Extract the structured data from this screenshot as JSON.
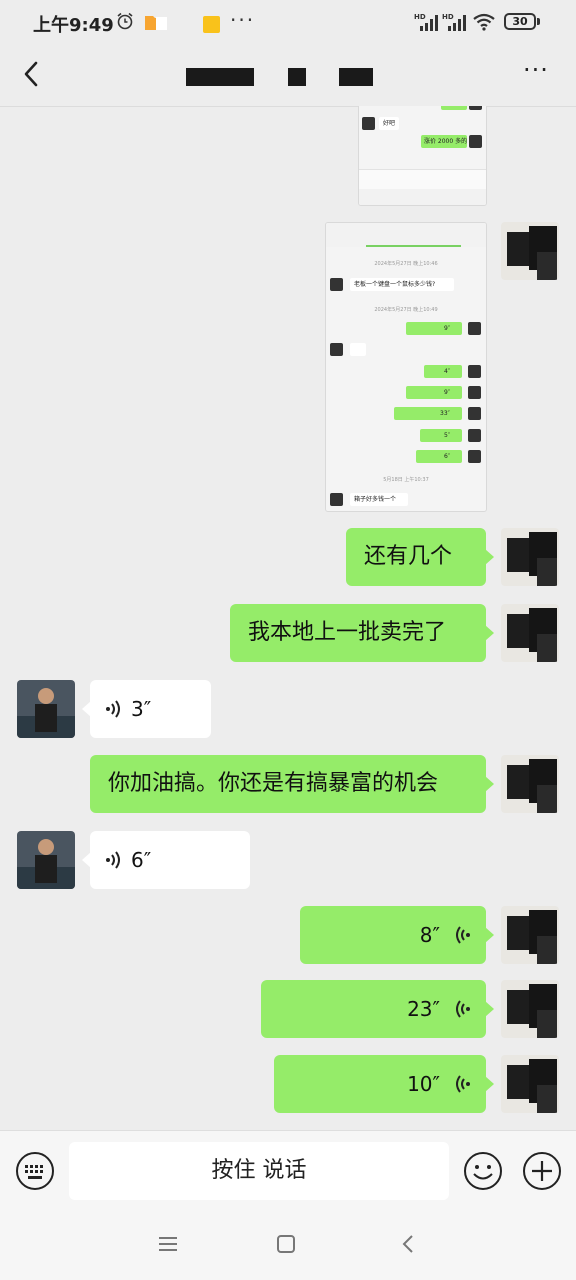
{
  "status_bar": {
    "time": "上午9:49",
    "more": "···",
    "battery": "30"
  },
  "header": {
    "more_label": "···"
  },
  "messages": [
    {
      "type": "image",
      "direction": "out",
      "description": "chat screenshot (top part)"
    },
    {
      "type": "image",
      "direction": "out",
      "description": "chat screenshot"
    },
    {
      "type": "text",
      "direction": "out",
      "text": "还有几个"
    },
    {
      "type": "text",
      "direction": "out",
      "text": "我本地上一批卖完了"
    },
    {
      "type": "voice",
      "direction": "in",
      "duration": "3″"
    },
    {
      "type": "text",
      "direction": "out",
      "text": "你加油搞。你还是有搞暴富的机会"
    },
    {
      "type": "voice",
      "direction": "in",
      "duration": "6″"
    },
    {
      "type": "voice",
      "direction": "out",
      "duration": "8″"
    },
    {
      "type": "voice",
      "direction": "out",
      "duration": "23″"
    },
    {
      "type": "voice",
      "direction": "out",
      "duration": "10″"
    }
  ],
  "screenshot_top": {
    "reply": "好吧",
    "msg": "涨价 2000 多的"
  },
  "screenshot": {
    "ts1": "2024年5月27日 晚上10:46",
    "q1": "老板一个键盘一个鼠标多少钱?",
    "ts2": "2024年5月27日 晚上10:49",
    "voices": [
      "9″",
      "4″",
      "9″",
      "33″",
      "5″",
      "6″"
    ],
    "ts3": "5月18日 上午10:37",
    "q2": "箱子好多钱一个"
  },
  "input_bar": {
    "hold_to_talk": "按住 说话"
  },
  "colors": {
    "bubble_out": "#95ec69",
    "bubble_in": "#ffffff",
    "background": "#ededed"
  }
}
